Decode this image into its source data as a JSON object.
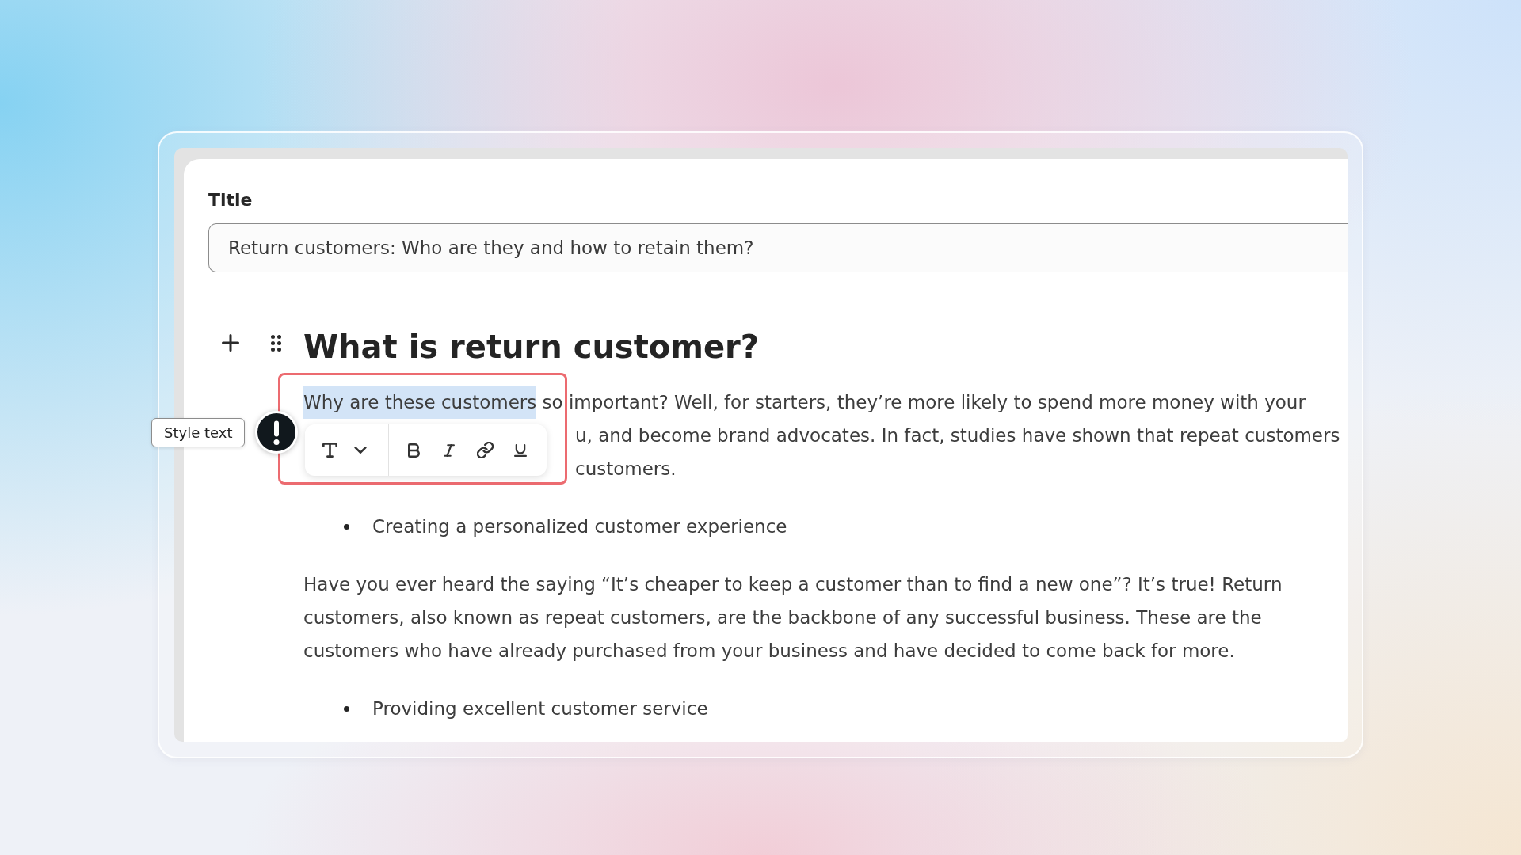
{
  "title_field": {
    "label": "Title",
    "value": "Return customers: Who are they and how to retain them?"
  },
  "editor": {
    "blocks": [
      {
        "kind": "heading",
        "text": "What is return customer?"
      },
      {
        "kind": "partial_paragraph",
        "lines": [
          {
            "covered": false,
            "segments": [
              {
                "text": "Why are these customers",
                "selected": true
              },
              {
                "text": "so important? Well, for starters, they’re more likely to spend more money with your",
                "selected": false
              }
            ]
          },
          {
            "covered": true,
            "segments": [
              {
                "text": "u, and become brand advocates. In fact, studies have shown that repeat customers",
                "selected": false
              }
            ]
          },
          {
            "covered": true,
            "segments": [
              {
                "text": "customers.",
                "selected": false
              }
            ]
          }
        ]
      },
      {
        "kind": "bullet",
        "text": "Creating a personalized customer experience"
      },
      {
        "kind": "paragraph",
        "text": "Have you ever heard the saying “It’s cheaper to keep a customer than to find a new one”? It’s true! Return customers, also known as repeat customers, are the backbone of any successful business. These are the customers who have already purchased from your business and have decided to come back for more."
      },
      {
        "kind": "bullet",
        "text": "Providing excellent customer service"
      }
    ]
  },
  "format_toolbar": {
    "tooltip": "Style text",
    "buttons": [
      {
        "kind": "text_style"
      },
      {
        "kind": "bold"
      },
      {
        "kind": "italic"
      },
      {
        "kind": "link"
      },
      {
        "kind": "underline"
      }
    ]
  }
}
